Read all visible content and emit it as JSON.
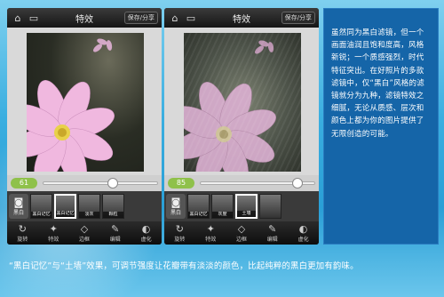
{
  "screens": [
    {
      "title": "特效",
      "save_share": "保存/分享",
      "slider_value": "61",
      "slider_percent": 61,
      "filter_button": "黑白",
      "filters": [
        "黑白记忆",
        "黑白记忆",
        "淡灰",
        "颗粒"
      ],
      "selected_filter_index": 1,
      "tools": [
        "旋转",
        "特效",
        "边框",
        "编辑",
        "虚化"
      ]
    },
    {
      "title": "特效",
      "save_share": "保存/分享",
      "slider_value": "85",
      "slider_percent": 85,
      "filter_button": "黑白",
      "filters": [
        "黑白记忆",
        "灰度",
        "土墙",
        ""
      ],
      "selected_filter_index": 2,
      "tools": [
        "旋转",
        "特效",
        "边框",
        "编辑",
        "虚化"
      ]
    }
  ],
  "article_text": "虽然同为黑白滤镜，但一个画面油润且饱和度高，风格新锐；一个质感强烈，时代特征突出。在好照片的多款滤镜中，仅“黑白”风格的滤镜就分为九种，滤镜特效之细腻，无论从质感、层次和颜色上都为你的图片提供了无限创造的可能。",
  "caption": "“黑白记忆”与“土墙”效果，可调节强度让花瓣带有淡淡的颜色，比起纯粹的黑白更加有韵味。",
  "icons": {
    "home": "home-icon",
    "folder": "folder-icon"
  },
  "colors": {
    "accent_green": "#8fc14a",
    "panel_blue": "#1565a8"
  }
}
